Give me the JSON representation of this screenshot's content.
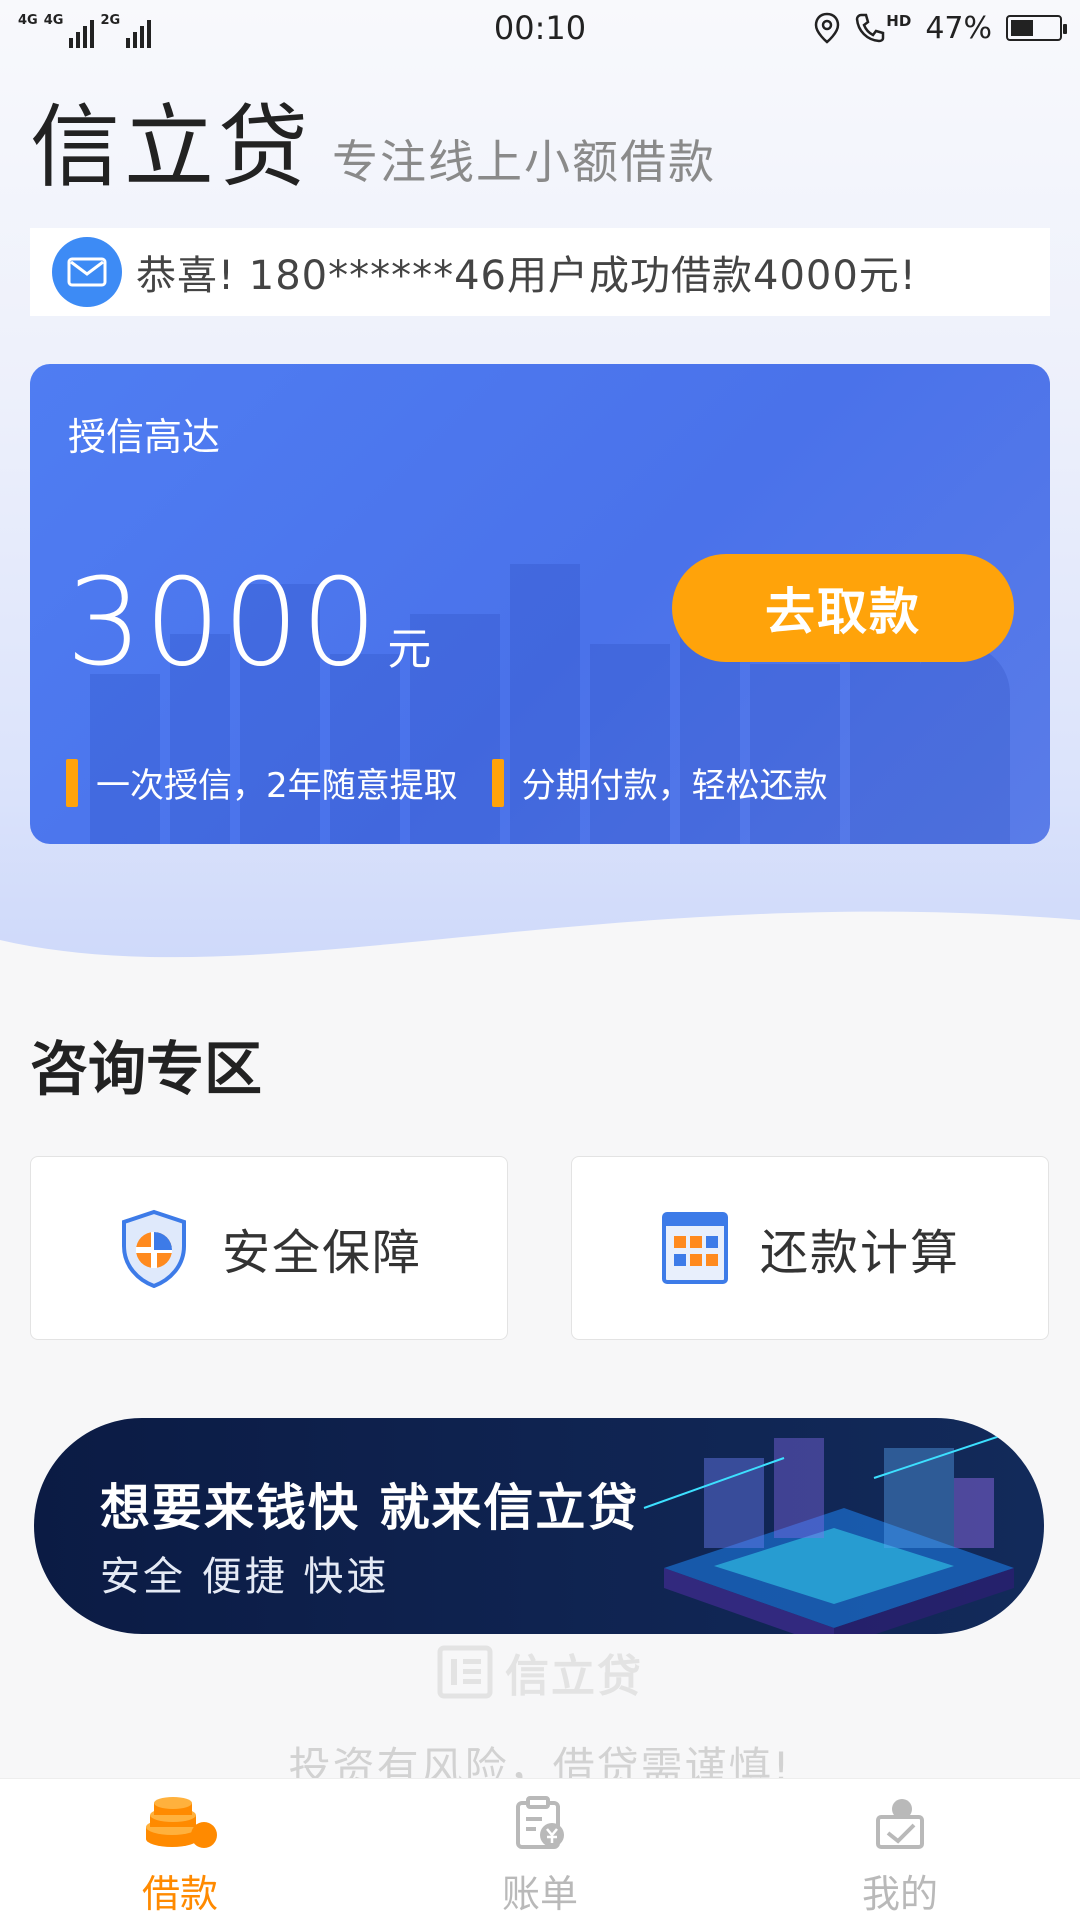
{
  "status_bar": {
    "network_left": "4G",
    "network_mid": "4G",
    "network_right": "2G",
    "time": "00:10",
    "hd": "HD",
    "battery": "47%"
  },
  "header": {
    "title": "信立贷",
    "slogan": "专注线上小额借款"
  },
  "notice": {
    "icon": "mail-icon",
    "text": "恭喜!    180******46用户成功借款4000元!"
  },
  "credit": {
    "label": "授信高达",
    "amount": "3000",
    "unit": "元",
    "button_label": "去取款",
    "features": [
      "一次授信，2年随意提取",
      "分期付款，轻松还款"
    ]
  },
  "consult": {
    "title": "咨询专区",
    "items": [
      {
        "label": "安全保障",
        "icon": "shield-icon"
      },
      {
        "label": "还款计算",
        "icon": "calculator-icon"
      }
    ]
  },
  "banner": {
    "title": "想要来钱快 就来信立贷",
    "subtitle": "安全 便捷 快速"
  },
  "footer": {
    "watermark": "信立贷",
    "risk_notice": "投资有风险，借贷需谨慎!"
  },
  "nav": {
    "items": [
      {
        "label": "借款",
        "icon": "coins-icon",
        "active": true
      },
      {
        "label": "账单",
        "icon": "bill-icon",
        "active": false
      },
      {
        "label": "我的",
        "icon": "profile-icon",
        "active": false
      }
    ]
  },
  "colors": {
    "accent": "#ffa30a",
    "card_blue": "#4f7df2",
    "active_nav": "#ff8a00"
  }
}
